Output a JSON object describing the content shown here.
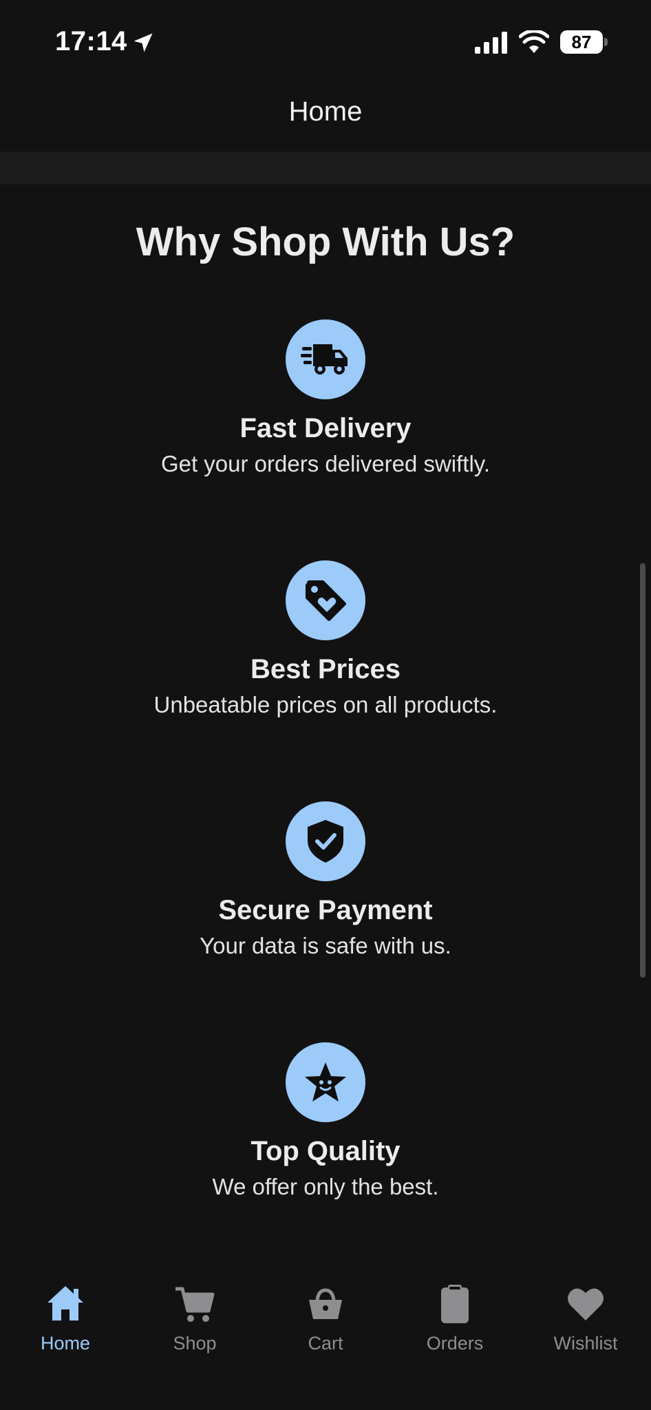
{
  "status_bar": {
    "time": "17:14",
    "battery": "87"
  },
  "header": {
    "title": "Home"
  },
  "section": {
    "title": "Why Shop With Us?"
  },
  "features": [
    {
      "icon": "truck-icon",
      "title": "Fast Delivery",
      "description": "Get your orders delivered swiftly."
    },
    {
      "icon": "price-tag-heart-icon",
      "title": "Best Prices",
      "description": "Unbeatable prices on all products."
    },
    {
      "icon": "shield-check-icon",
      "title": "Secure Payment",
      "description": "Your data is safe with us."
    },
    {
      "icon": "star-icon",
      "title": "Top Quality",
      "description": "We offer only the best."
    }
  ],
  "tabs": [
    {
      "label": "Home",
      "icon": "home-icon",
      "active": true
    },
    {
      "label": "Shop",
      "icon": "cart-icon",
      "active": false
    },
    {
      "label": "Cart",
      "icon": "basket-icon",
      "active": false
    },
    {
      "label": "Orders",
      "icon": "clipboard-icon",
      "active": false
    },
    {
      "label": "Wishlist",
      "icon": "heart-icon",
      "active": false
    }
  ],
  "colors": {
    "background": "#121213",
    "accent": "#9ccbfa",
    "inactive_tab": "#8e8e90",
    "text": "#ececed"
  }
}
